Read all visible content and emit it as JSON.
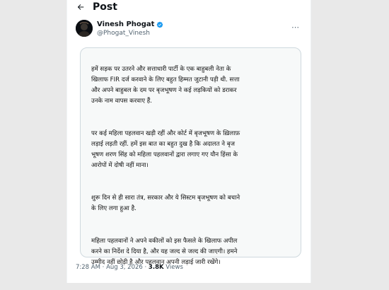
{
  "topbar": {
    "title": "Post"
  },
  "author": {
    "name": "Vinesh Phogat",
    "handle": "@Phogat_Vinesh",
    "verified_color": "#1d9bf0"
  },
  "post_image": {
    "paragraphs": [
      "हमें सड़क पर उतरने और सत्ताधारी पार्टी के एक बाहुबली नेता के\nखिलाफ FIR दर्ज करवाने के लिए बहुत हिम्मत जुटानी पड़ी थी. सत्ता\nऔर अपने बाहुबल के दम पर बृजभूषण ने कई लड़कियों को डराकर\nउनके नाम वापस करवाए हैं.",
      "पर कई महिला पहलवान खड़ी रहीं और कोर्ट में बृजभूषण के ख़िलाफ़\nलड़ाई लड़ती रहीं. हमें इस बात का बहुत दुख है कि अदालत ने बृज\nभूषण शरण सिंह को महिला पहलवानों द्वारा लगाए गए यौन हिंसा के\nआरोपों में दोषी नहीं माना।",
      "शुरू दिन से ही सारा तंत्र, सरकार और ये सिस्टम बृजभूषण को बचाने\nके लिए लगा हुआ है.",
      "महिला पहलवानों ने अपने वकीलों को इस फैसले के खिलाफ अपील\nकरने का निर्देश दे दिया है, और यह जल्द से जल्द की जाएगी। हमने\nउम्मीद नहीं छोड़ी है और पहलवान अपनी लड़ाई जारी रखेंगे।"
    ]
  },
  "footer": {
    "time": "7:28 AM",
    "separator": "·",
    "date": "Aug 3, 2026",
    "views_count": "3.8K",
    "views_label": "Views"
  },
  "icons": {
    "back": "arrow-left-icon",
    "verified": "verified-badge-icon",
    "more": "more-options-icon"
  }
}
